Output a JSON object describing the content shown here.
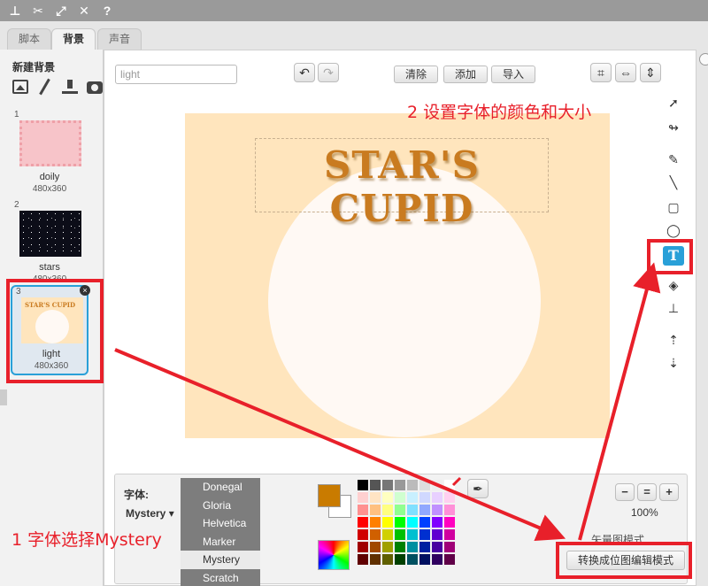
{
  "tabs": [
    {
      "label": "脚本"
    },
    {
      "label": "背景"
    },
    {
      "label": "声音"
    }
  ],
  "left_panel": {
    "header": "新建背景",
    "backdrops": [
      {
        "num": "1",
        "name": "doily",
        "size": "480x360"
      },
      {
        "num": "2",
        "name": "stars",
        "size": "480x360"
      },
      {
        "num": "3",
        "name": "light",
        "size": "480x360",
        "mini_title": "STAR'S CUPID"
      }
    ]
  },
  "editor": {
    "name_value": "light",
    "buttons": {
      "clear": "清除",
      "add": "添加",
      "import": "导入"
    },
    "canvas_title": "STAR'S CUPID"
  },
  "text_panel": {
    "font_label": "字体:",
    "selected_font": "Mystery",
    "font_options": [
      "Donegal",
      "Gloria",
      "Helvetica",
      "Marker",
      "Mystery",
      "Scratch"
    ],
    "zoom_level": "100%",
    "mode_label": "矢量图模式",
    "convert_button": "转换成位图编辑模式"
  },
  "colors": {
    "primary": "#c97b00",
    "secondary": "#ffffff",
    "accent": "#29a0d8",
    "annotation": "#e8202a",
    "palette": [
      "#000000",
      "#555555",
      "#777777",
      "#999999",
      "#bbbbbb",
      "#dddddd",
      "#eeeeee",
      "#ffffff",
      "#ffd0d0",
      "#ffe4c4",
      "#ffffc0",
      "#d0ffd0",
      "#c8f0ff",
      "#d0d8ff",
      "#e8d0ff",
      "#ffd0f0",
      "#ff9090",
      "#ffc080",
      "#ffff80",
      "#90ff90",
      "#80e0ff",
      "#90a8ff",
      "#c090ff",
      "#ff90d8",
      "#ff0000",
      "#ff8000",
      "#ffff00",
      "#00ff00",
      "#00ffff",
      "#0040ff",
      "#8000ff",
      "#ff00c0",
      "#d00000",
      "#d06000",
      "#d0d000",
      "#00c000",
      "#00c0d0",
      "#0030d0",
      "#6000d0",
      "#d000a0",
      "#a00000",
      "#a04800",
      "#a0a000",
      "#008000",
      "#0090a0",
      "#0020a0",
      "#4800a0",
      "#a00078",
      "#600000",
      "#603000",
      "#606000",
      "#004000",
      "#005060",
      "#001060",
      "#300060",
      "#600048"
    ]
  },
  "annotations": {
    "step1": "1 字体选择Mystery",
    "step2": "2 设置字体的颜色和大小"
  }
}
